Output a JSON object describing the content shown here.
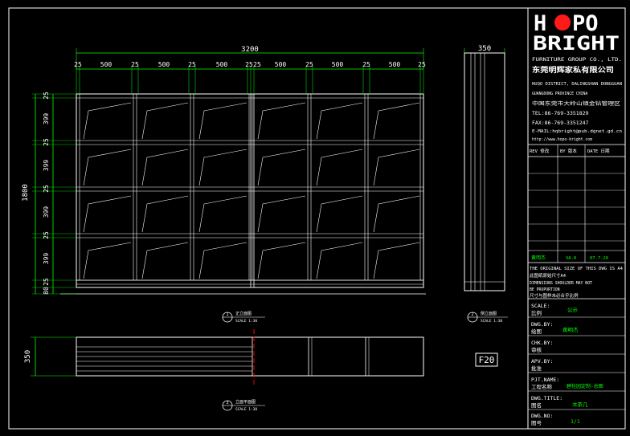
{
  "elevation": {
    "overall_width": "3200",
    "overall_height": "1800",
    "depth": "350",
    "top_dims": [
      "25",
      "500",
      "25",
      "500",
      "25",
      "500",
      "25",
      "25",
      "500",
      "25",
      "500",
      "25",
      "500",
      "25"
    ],
    "left_dims": [
      "25",
      "399",
      "25",
      "399",
      "25",
      "399",
      "25",
      "399",
      "25",
      "80"
    ],
    "front_label": "正立面图",
    "side_label": "侧立面图",
    "plan_label": "立面平面图",
    "scale_text": "SCALE 1:30",
    "front_marker": "1",
    "side_marker": "2",
    "plan_marker": "3"
  },
  "plan": {
    "depth_dim": "350",
    "sheet_no": "F20"
  },
  "title_block": {
    "logo_line1_pre": "H",
    "logo_line1_post": "PO",
    "logo_line2": "BRIGHT",
    "company_en": "FURNITURE GROUP CO., LTD.",
    "company_cn": "东莞明辉家私有限公司",
    "address_en_1": "HUQO DISTRICT, DALINGSHAN DONGGUAN",
    "address_en_2": "GUANGDONG PROVINCE CHINA",
    "address_cn": "中国东莞市大岭山镇金钻管理区",
    "tel": "TEL:86-769-3351829",
    "fax": "FAX:86-769-3351247",
    "email": "E-MAIL:hqbright@pub.dgnet.gd.cn",
    "web": "http://www.hopo-bright.com",
    "rev_headers": [
      "REV 修改",
      "BY 版本",
      "DATE 日期"
    ],
    "rev_row": [
      "黄明杰",
      "VA.0",
      "07.7.26"
    ],
    "note_1": "THE ORIGINAL SIZE OF THIS DWG IS A4",
    "note_2": "此图纸原始尺寸A4",
    "note_3": "DIMENSIONS SHOULDER MAY NOT",
    "note_4": "BE PROPORTION",
    "note_5": "尺寸与图样未必合乎比例",
    "scale_label_en": "SCALE:",
    "scale_label_cn": "比例",
    "scale_value": "公示",
    "drawn_label_en": "DWG.BY:",
    "drawn_label_cn": "绘图",
    "drawn_value": "黄明杰",
    "chk_label_en": "CHK.BY:",
    "chk_label_cn": "审核",
    "apv_label_en": "APV.BY:",
    "apv_label_cn": "批准",
    "pjt_label_en": "PJT.NAME:",
    "pjt_label_cn": "工程名称",
    "pjt_value": "碧桂园定制-总图",
    "title_label_en": "DWG.TITLE:",
    "title_label_cn": "图名",
    "title_value": "木茶几",
    "no_label_en": "DWG.NO:",
    "no_label_cn": "图号",
    "no_value": "1/1"
  },
  "colors": {
    "background": "#000000",
    "line": "#ffffff",
    "dimension": "#00ff00",
    "text_green": "#00ff00",
    "logo_red": "#ff1a1a",
    "section_red": "#ff0000"
  }
}
